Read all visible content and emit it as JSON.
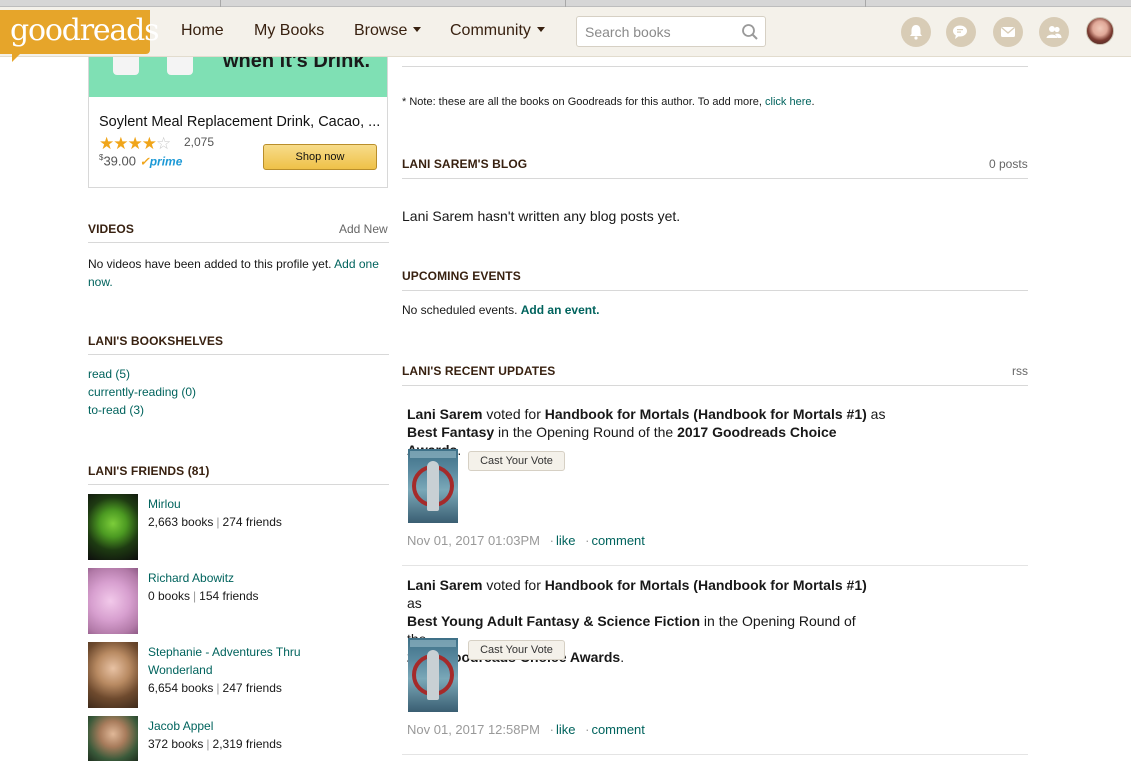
{
  "header": {
    "logo_text": "goodreads",
    "nav": [
      "Home",
      "My Books",
      "Browse",
      "Community"
    ],
    "search_placeholder": "Search books",
    "icons": [
      "notifications-icon",
      "discussions-icon",
      "messages-icon",
      "friends-icon",
      "profile-avatar"
    ]
  },
  "ad": {
    "tagline": "when it's Drink.",
    "title": "Soylent Meal Replacement Drink, Cacao, ...",
    "stars": "★★★★",
    "stars_empty": "☆",
    "rating_value": 4,
    "rating_count": "2,075",
    "price_currency": "$",
    "price": "39.00",
    "prime": "prime",
    "shop_button": "Shop now"
  },
  "videos": {
    "heading": "VIDEOS",
    "add_new": "Add New",
    "empty_text": "No videos have been added to this profile yet.",
    "add_link": "Add one now."
  },
  "bookshelves": {
    "heading": "LANI'S BOOKSHELVES",
    "items": [
      "read (5)",
      "currently-reading (0)",
      "to-read (3)"
    ]
  },
  "friends": {
    "heading": "LANI'S FRIENDS (81)",
    "items": [
      {
        "name": "Mirlou",
        "books": "2,663 books",
        "friends": "274 friends"
      },
      {
        "name": "Richard Abowitz",
        "books": "0 books",
        "friends": "154 friends"
      },
      {
        "name_line1": "Stephanie - Adventures Thru",
        "name_line2": "Wonderland",
        "books": "6,654 books",
        "friends": "247 friends"
      },
      {
        "name": "Jacob Appel",
        "books": "372 books",
        "friends": "2,319 friends"
      }
    ]
  },
  "note": {
    "text": "* Note: these are all the books on Goodreads for this author. To add more, ",
    "link": "click here",
    "end": "."
  },
  "blog": {
    "heading": "LANI SAREM'S BLOG",
    "count": "0 posts",
    "text": "Lani Sarem hasn't written any blog posts yet."
  },
  "events": {
    "heading": "UPCOMING EVENTS",
    "text": "No scheduled events.",
    "link": "Add an event."
  },
  "updates": {
    "heading": "LANI'S RECENT UPDATES",
    "rss": "rss",
    "items": [
      {
        "user": "Lani Sarem",
        "verb": " voted for ",
        "book": "Handbook for Mortals (Handbook for Mortals #1)",
        "as": " as",
        "category": "Best Fantasy",
        "mid": " in the Opening Round of the ",
        "award": "2017 Goodreads Choice Awards",
        "end": ".",
        "button": "Cast Your Vote",
        "time": "Nov 01, 2017 01:03PM",
        "like": "like",
        "comment": "comment"
      },
      {
        "user": "Lani Sarem",
        "verb": " voted for ",
        "book": "Handbook for Mortals (Handbook for Mortals #1)",
        "as": " as",
        "category": "Best Young Adult Fantasy & Science Fiction",
        "mid": " in the Opening Round of the",
        "award": "2017 Goodreads Choice Awards",
        "end": ".",
        "button": "Cast Your Vote",
        "time": "Nov 01, 2017 12:58PM",
        "like": "like",
        "comment": "comment"
      }
    ]
  },
  "colors": {
    "header_bg": "#f4f1ea",
    "logo_bg": "#e6a52a",
    "link": "#00635d",
    "heading": "#382110",
    "ad_banner": "#7fe0b4"
  }
}
